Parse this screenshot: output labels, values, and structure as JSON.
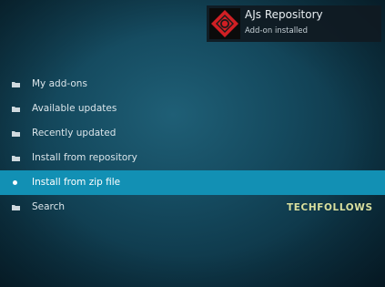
{
  "notification": {
    "title": "AJs Repository",
    "subtitle": "Add-on installed",
    "icon": "ajs-logo-icon",
    "icon_color": "#d11f24"
  },
  "menu": {
    "items": [
      {
        "label": "My add-ons",
        "icon": "folder-icon",
        "selected": false
      },
      {
        "label": "Available updates",
        "icon": "folder-icon",
        "selected": false
      },
      {
        "label": "Recently updated",
        "icon": "folder-icon",
        "selected": false
      },
      {
        "label": "Install from repository",
        "icon": "folder-icon",
        "selected": false
      },
      {
        "label": "Install from zip file",
        "icon": "dot-icon",
        "selected": true
      },
      {
        "label": "Search",
        "icon": "folder-icon",
        "selected": false
      }
    ]
  },
  "watermark": {
    "text": "TECHFOLLOWS"
  },
  "colors": {
    "selection": "#1290b4",
    "background": "#154b60"
  }
}
